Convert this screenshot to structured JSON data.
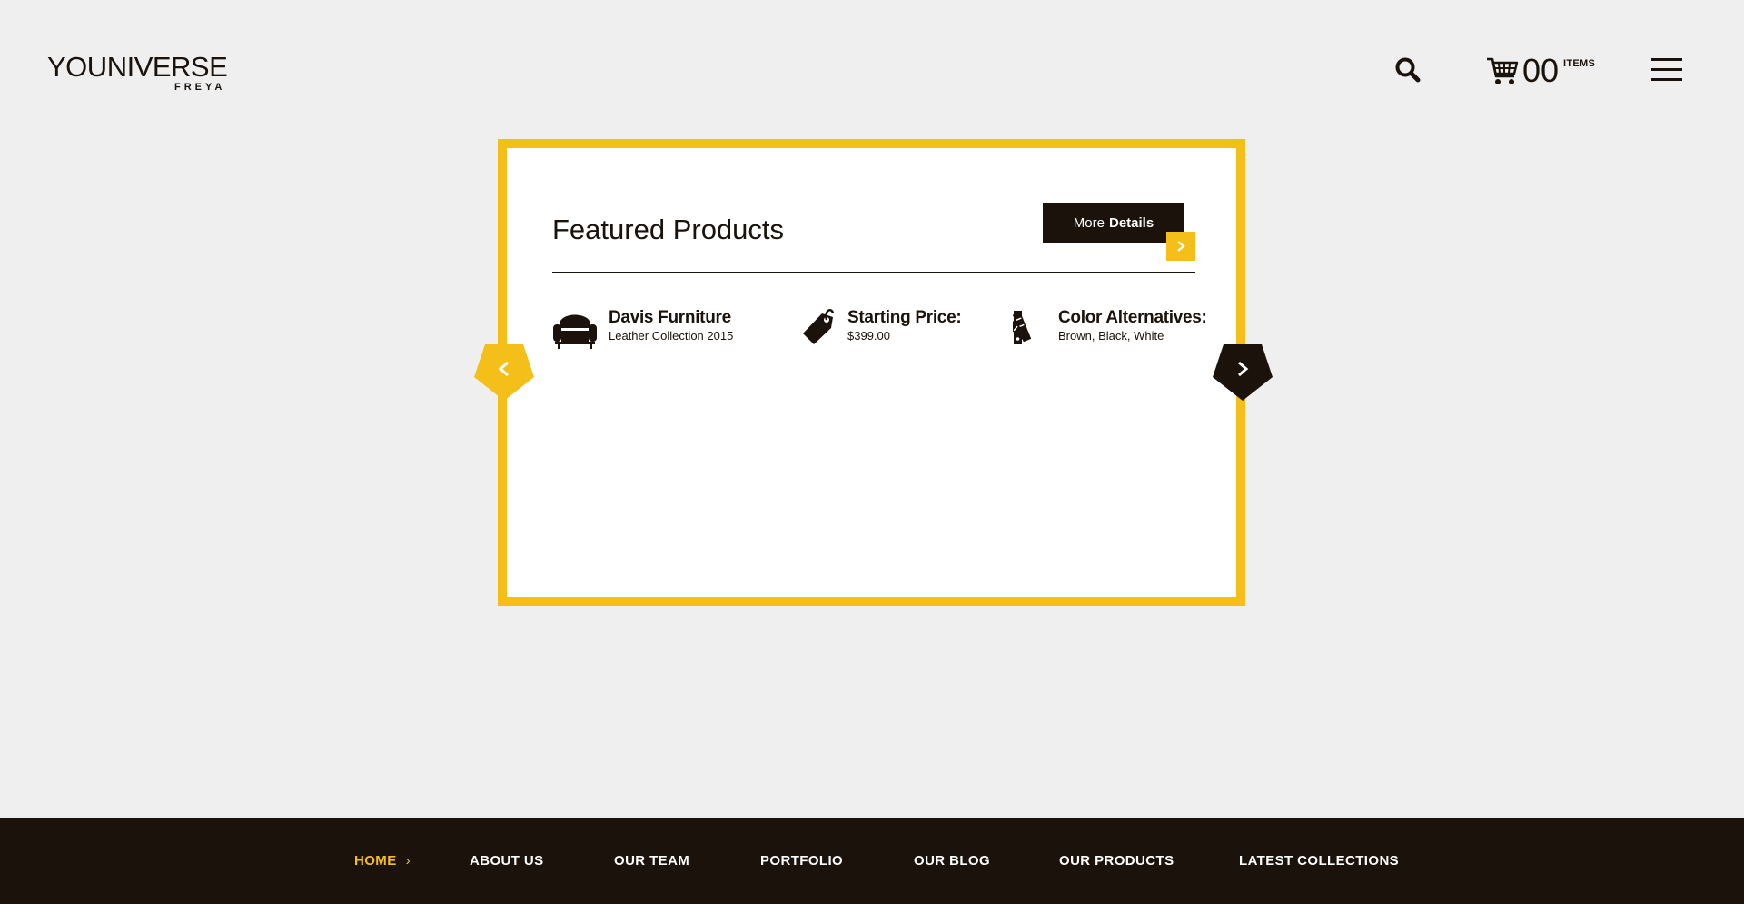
{
  "brand": {
    "logo_primary_bold": "YOU",
    "logo_primary_light": "NIVERSE",
    "logo_secondary": "FREYA"
  },
  "header": {
    "cart_count": "00",
    "cart_items_label": "ITEMS"
  },
  "featured": {
    "title": "Featured Products",
    "button_label_regular": "More",
    "button_label_bold": "Details",
    "items": [
      {
        "icon": "armchair-icon",
        "title": "Davis Furniture",
        "subtitle": "Leather Collection 2015"
      },
      {
        "icon": "price-tag-icon",
        "title": "Starting Price:",
        "subtitle": "$399.00"
      },
      {
        "icon": "color-swatches-icon",
        "title": "Color Alternatives:",
        "subtitle": "Brown, Black, White"
      }
    ]
  },
  "nav": {
    "items": [
      "HOME",
      "ABOUT US",
      "OUR TEAM",
      "PORTFOLIO",
      "OUR BLOG",
      "OUR PRODUCTS",
      "LATEST COLLECTIONS"
    ],
    "active": "HOME"
  },
  "colors": {
    "background": "#efefef",
    "accent": "#f5bf1a",
    "dark": "#1a120b",
    "card": "#ffffff"
  }
}
